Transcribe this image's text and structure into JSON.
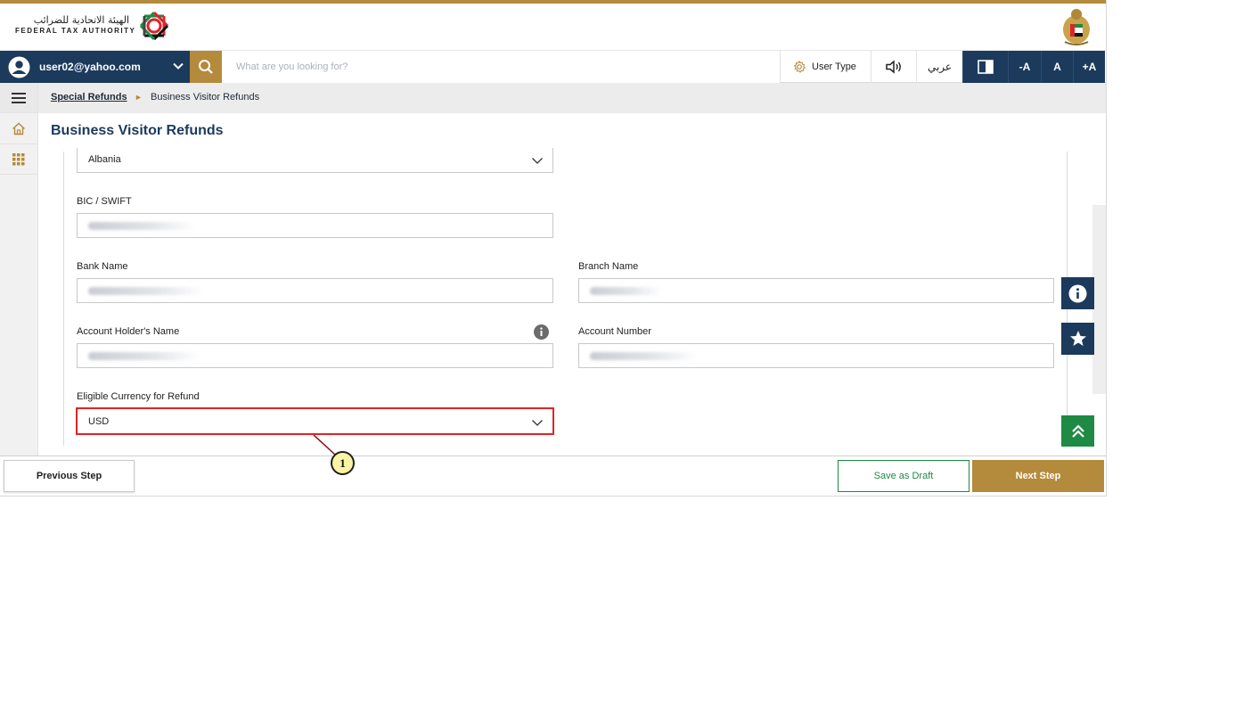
{
  "header": {
    "logo_ar": "الهيئة الاتحادية للضرائب",
    "logo_en": "FEDERAL TAX AUTHORITY"
  },
  "toolbar": {
    "user_email": "user02@yahoo.com",
    "search_placeholder": "What are you looking for?",
    "user_type_label": "User Type",
    "language_label": "عربي",
    "font_decrease": "-A",
    "font_normal": "A",
    "font_increase": "+A"
  },
  "breadcrumb": {
    "parent": "Special Refunds",
    "separator": "►",
    "current": "Business Visitor Refunds"
  },
  "page": {
    "title": "Business Visitor Refunds"
  },
  "form": {
    "country_value": "Albania",
    "bic_label": "BIC / SWIFT",
    "bank_name_label": "Bank Name",
    "branch_name_label": "Branch Name",
    "account_holder_label": "Account Holder's Name",
    "account_number_label": "Account Number",
    "currency_label": "Eligible Currency for Refund",
    "currency_value": "USD"
  },
  "footer": {
    "previous_label": "Previous Step",
    "draft_label": "Save as Draft",
    "next_label": "Next Step"
  },
  "annotation": {
    "callout_number": "1"
  },
  "colors": {
    "navy": "#1b3a5c",
    "gold": "#b48a3c",
    "green": "#1e8a43",
    "highlight_red": "#e02424",
    "callout_yellow": "#fbf3a4"
  },
  "icons": {
    "user": "user-avatar-icon",
    "search": "search-icon",
    "gear": "gear-icon",
    "speaker": "speaker-icon",
    "contrast": "contrast-icon",
    "menu": "hamburger-icon",
    "home": "home-icon",
    "apps": "apps-grid-icon",
    "info": "info-icon",
    "star": "star-icon",
    "scroll_top": "double-chevron-up-icon"
  }
}
